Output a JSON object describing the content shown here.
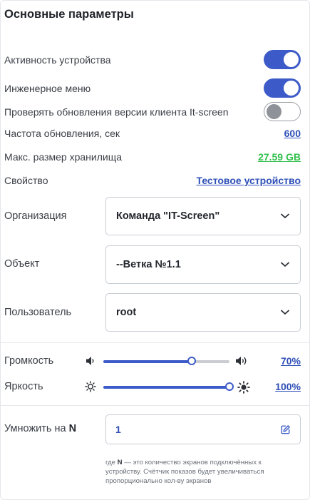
{
  "panel": {
    "title": "Основные параметры"
  },
  "toggles": [
    {
      "label": "Активность устройства",
      "on": true
    },
    {
      "label": "Инженерное меню",
      "on": true
    },
    {
      "label": "Проверять обновления версии клиента It-screen",
      "on": false
    }
  ],
  "info": {
    "refresh_label": "Частота обновления, сек",
    "refresh_value": "600",
    "storage_label": "Макс. размер хранилища",
    "storage_value": "27.59 GB",
    "property_label": "Свойство",
    "property_value": "Тестовое устройство"
  },
  "selects": {
    "organization": {
      "label": "Организация",
      "value": "Команда \"IT-Screen\""
    },
    "object": {
      "label": "Объект",
      "value": "--Ветка №1.1"
    },
    "user": {
      "label": "Пользователь",
      "value": "root"
    }
  },
  "sliders": {
    "volume": {
      "label": "Громкость",
      "value_text": "70%",
      "value": 0.7
    },
    "brightness": {
      "label": "Яркость",
      "value_text": "100%",
      "value": 1.0
    }
  },
  "multiply": {
    "label_prefix": "Умножить на ",
    "label_n": "N",
    "value": "1",
    "note_n": "N",
    "note_text": " — это количество экранов подключённых к устройству. Счётчик показов будет увеличиваться пропорционально кол-ву экранов",
    "note_prefix": "где "
  },
  "colors": {
    "accent": "#3d5bc8",
    "link": "#2f4fb7",
    "green": "#2fbf4a",
    "toggle_off": "#8f9298"
  }
}
